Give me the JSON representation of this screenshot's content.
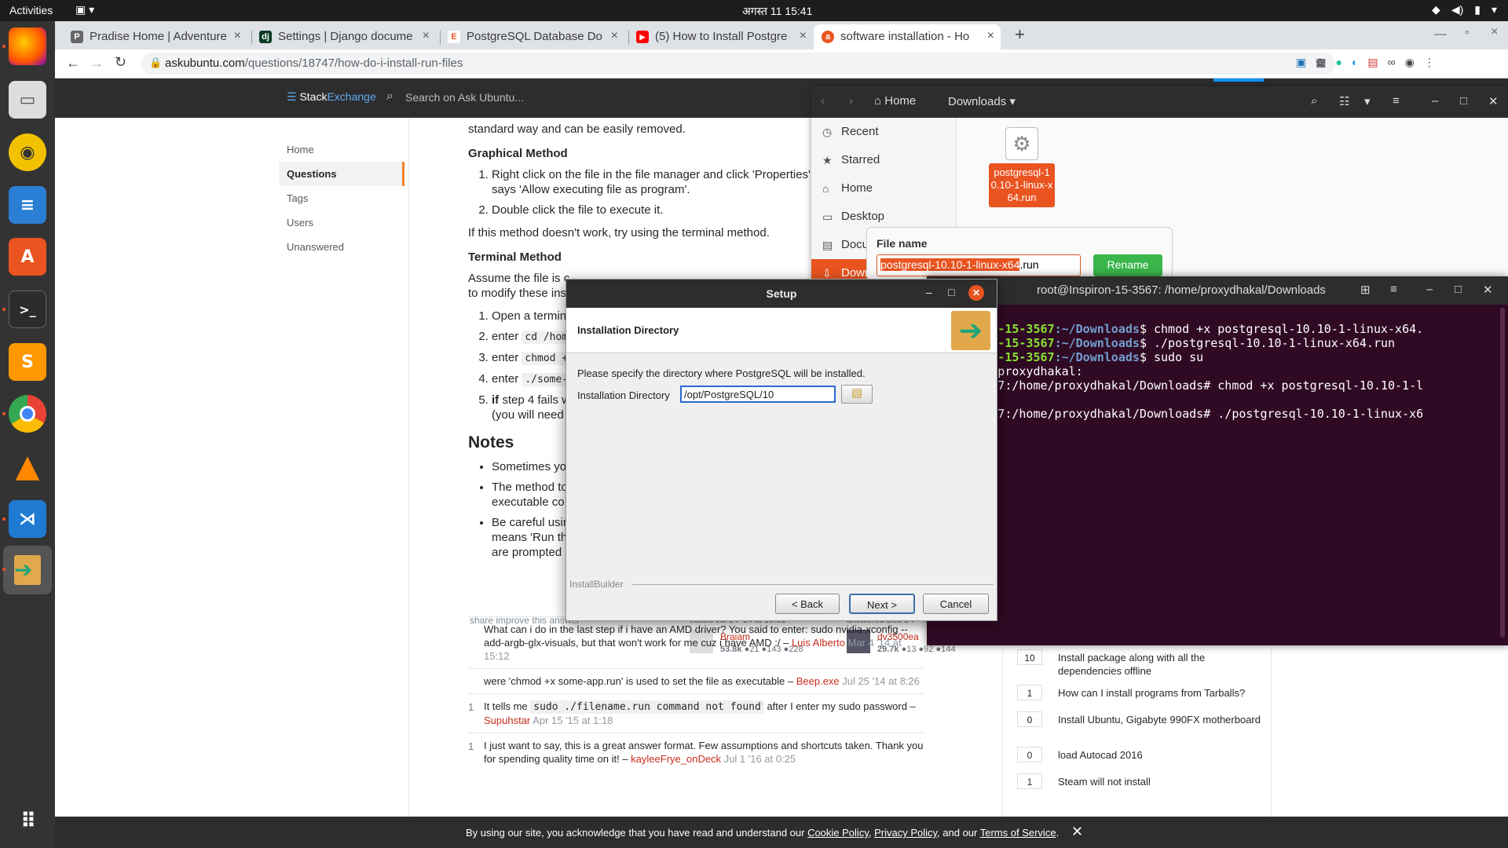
{
  "topbar": {
    "activities": "Activities",
    "clock": "अगस्त 11  15:41"
  },
  "tabs": [
    {
      "title": "Pradise Home | Adventure",
      "icon": "P"
    },
    {
      "title": "Settings | Django docume",
      "icon": "dj"
    },
    {
      "title": "PostgreSQL Database Do",
      "icon": "E"
    },
    {
      "title": "(5) How to Install Postgre",
      "icon": "▶"
    },
    {
      "title": "software installation - Ho",
      "icon": "a"
    }
  ],
  "address": {
    "domain": "askubuntu.com",
    "path": "/questions/18747/how-do-i-install-run-files"
  },
  "site": {
    "brand_a": "Stack",
    "brand_b": "Exchange",
    "search_placeholder": "Search on Ask Ubuntu..."
  },
  "leftnav": [
    "Home",
    "Questions",
    "Tags",
    "Users",
    "Unanswered"
  ],
  "content": {
    "intro": "standard way and can be easily removed.",
    "graphical_title": "Graphical Method",
    "g1": "Right click on the file in the file manager and click 'Properties'. Check the box that says 'Allow executing file as program'.",
    "g2": "Double click the file to execute it.",
    "fallback": "If this method doesn't work, try using the terminal method.",
    "terminal_title": "Terminal Method",
    "assume": "Assume the file is c",
    "assume2": "to modify these ins",
    "t1": "Open a termin",
    "t2": "enter",
    "t2c": "cd /hom",
    "t3": "enter",
    "t3c": "chmod +",
    "t4": "enter",
    "t4c": "./some-",
    "t5a": "if",
    "t5": " step 4 fails w",
    "t5b": "(you will need",
    "notes_title": "Notes",
    "n1": "Sometimes yo",
    "n2": "The method to",
    "n2b": "executable co",
    "n3": "Be careful usin",
    "n3b": "means 'Run th",
    "n3c": "are prompted",
    "share": "share  improve this answer",
    "edited": "edited Jul 24 '14 at 19:51",
    "editor": "Braiam",
    "editor_rep": "53.8k",
    "editor_badges": "●21 ●143 ●228",
    "answered": "answered Dec 24",
    "answerer": "dv3500ea",
    "answerer_rep": "29.7k",
    "answerer_badges": "●13 ●92 ●144"
  },
  "comments": [
    {
      "score": "",
      "text": "What can i do in the last step if i have an AMD driver? You said to enter: sudo nvidia-xconfig --add-argb-glx-visuals, but that won't work for me cuz i have AMD :/ – ",
      "user": "Luis Alberto",
      "date": " Mar 4 '14 at 15:12"
    },
    {
      "score": "",
      "text": "were 'chmod +x some-app.run' is used to set the file as executable – ",
      "user": "Beep.exe",
      "date": " Jul 25 '14 at 8:26"
    },
    {
      "score": "1",
      "text": "It tells me ",
      "code": "sudo ./filename.run command not found",
      "text2": " after I enter my sudo password – ",
      "user": "Supuhstar",
      "date": " Apr 15 '15 at 1:18"
    },
    {
      "score": "1",
      "text": "I just want to say, this is a great answer format. Few assumptions and shortcuts taken. Thank you for spending quality time on it! – ",
      "user": "kayleeFrye_onDeck",
      "date": " Jul 1 '16 at 0:25"
    }
  ],
  "related": [
    {
      "score": "10",
      "text": "Install package along with all the dependencies offline"
    },
    {
      "score": "1",
      "text": "How can I install programs from Tarballs?"
    },
    {
      "score": "0",
      "text": "Install Ubuntu, Gigabyte 990FX motherboard"
    },
    {
      "score": "0",
      "text": "load Autocad 2016"
    },
    {
      "score": "1",
      "text": "Steam will not install"
    }
  ],
  "cookie": {
    "prefix": "By using our site, you acknowledge that you have read and understand our ",
    "l1": "Cookie Policy",
    "sep1": ", ",
    "l2": "Privacy Policy",
    "sep2": ", and our ",
    "l3": "Terms of Service",
    "end": "."
  },
  "files": {
    "home": "Home",
    "downloads": "Downloads",
    "sidebar": [
      "Recent",
      "Starred",
      "Home",
      "Desktop",
      "Docu",
      "Down"
    ],
    "file_label": "postgresql-10.10-1-linux-x64.run",
    "rename_title": "File name",
    "rename_sel": "postgresql-10.10-1-linux-x64",
    "rename_ext": ".run",
    "rename_btn": "Rename"
  },
  "terminal": {
    "title": "root@Inspiron-15-3567: /home/proxydhakal/Downloads",
    "lines": [
      {
        "p1": "l@Inspiron-15-3567",
        "p2": ":~/Downloads",
        "cmd": "$ chmod +x postgresql-10.10-1-linux-x64."
      },
      {
        "p1": "l@Inspiron-15-3567",
        "p2": ":~/Downloads",
        "cmd": "$ ./postgresql-10.10-1-linux-x64.run"
      },
      {
        "p1": "l@Inspiron-15-3567",
        "p2": ":~/Downloads",
        "cmd": "$ sudo su"
      },
      {
        "plain": "sword for proxydhakal:"
      },
      {
        "plain": "ron-15-3567:/home/proxydhakal/Downloads# chmod +x postgresql-10.10-1-l"
      },
      {
        "plain": "run"
      },
      {
        "plain": "ron-15-3567:/home/proxydhakal/Downloads# ./postgresql-10.10-1-linux-x6"
      }
    ]
  },
  "setup": {
    "title": "Setup",
    "header": "Installation Directory",
    "instruction": "Please specify the directory where PostgreSQL will be installed.",
    "dir_label": "Installation Directory",
    "dir_value": "/opt/PostgreSQL/10",
    "footer": "InstallBuilder",
    "back": "< Back",
    "next": "Next >",
    "cancel": "Cancel"
  },
  "colors": {
    "ubuntu_orange": "#e95420",
    "terminal_bg": "#300a24",
    "so_orange": "#f48024"
  }
}
